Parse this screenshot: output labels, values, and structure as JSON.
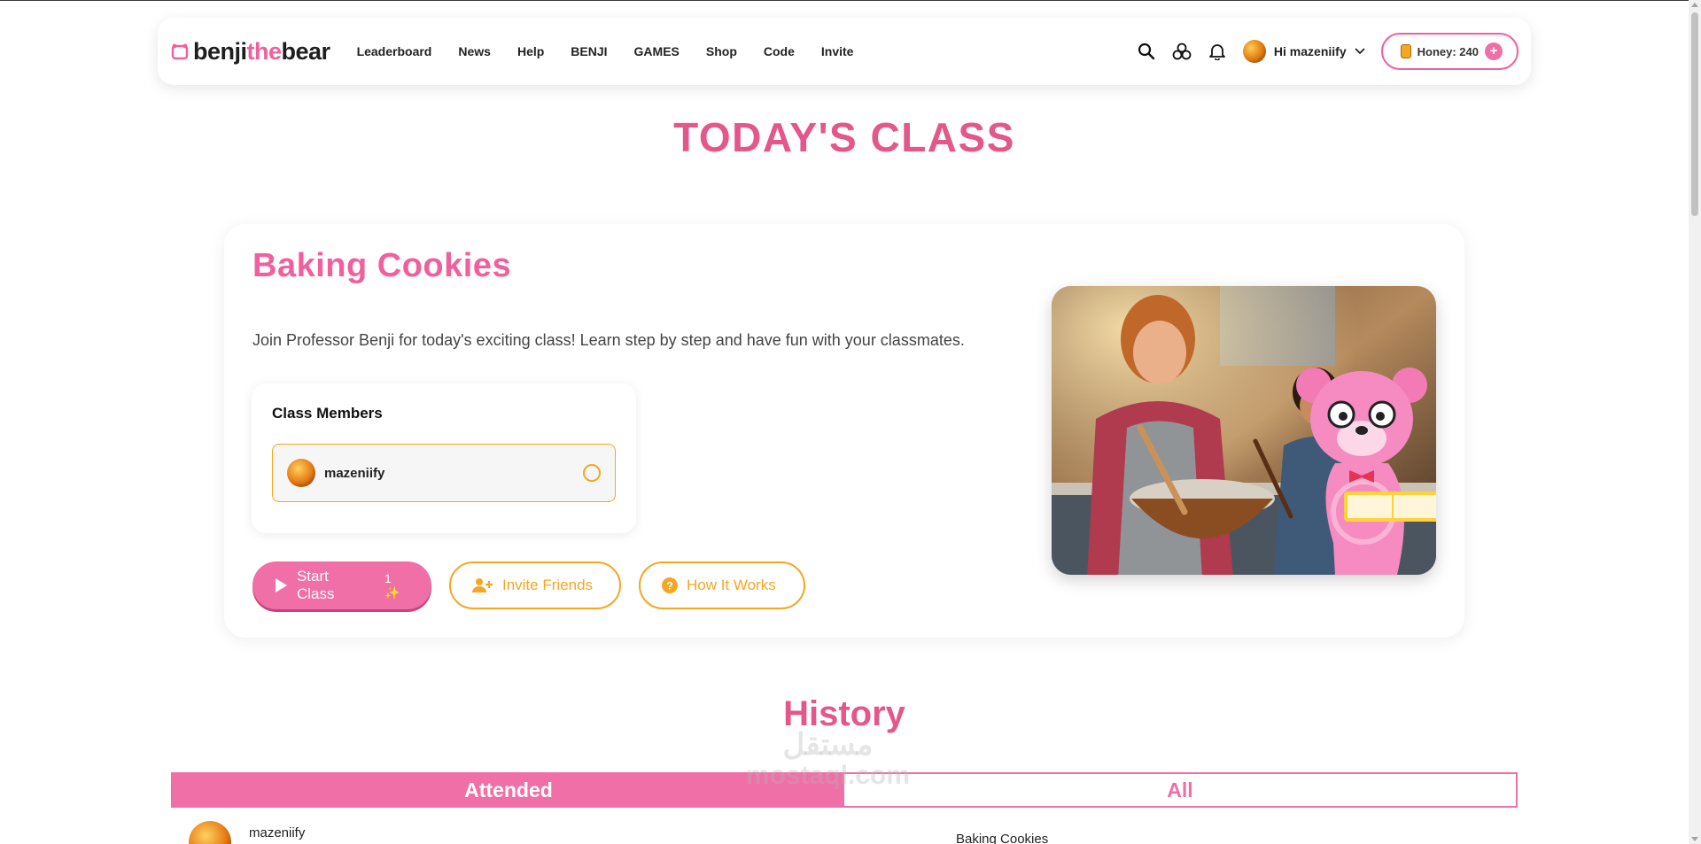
{
  "brand": {
    "part1": "benji",
    "part2": "the",
    "part3": "bear"
  },
  "nav": {
    "links": [
      "Leaderboard",
      "News",
      "Help",
      "BENJI",
      "GAMES",
      "Shop",
      "Code",
      "Invite"
    ],
    "greeting": "Hi mazeniify",
    "honey_label": "Honey: 240",
    "icons": [
      "search-icon",
      "hexagon-cluster-icon",
      "bell-icon",
      "chevron-down-icon",
      "honey-jar-icon",
      "plus-icon"
    ]
  },
  "page": {
    "title": "TODAY'S CLASS"
  },
  "class": {
    "name": "Baking Cookies",
    "description": "Join Professor Benji for today's exciting class! Learn step by step and have fun with your classmates.",
    "members_heading": "Class Members",
    "members": [
      {
        "name": "mazeniify"
      }
    ],
    "buttons": {
      "start": "Start Class",
      "start_count": "1",
      "invite": "Invite Friends",
      "how": "How It Works"
    }
  },
  "history": {
    "title": "History",
    "tabs": [
      "Attended",
      "All"
    ],
    "rows": [
      {
        "user": "mazeniify",
        "class": "Baking Cookies"
      }
    ]
  },
  "watermark": {
    "line1": "مستقل",
    "line2": "mostaql.com"
  },
  "colors": {
    "pink": "#f06fa6",
    "title_pink": "#e4578a",
    "orange": "#f5a623"
  }
}
